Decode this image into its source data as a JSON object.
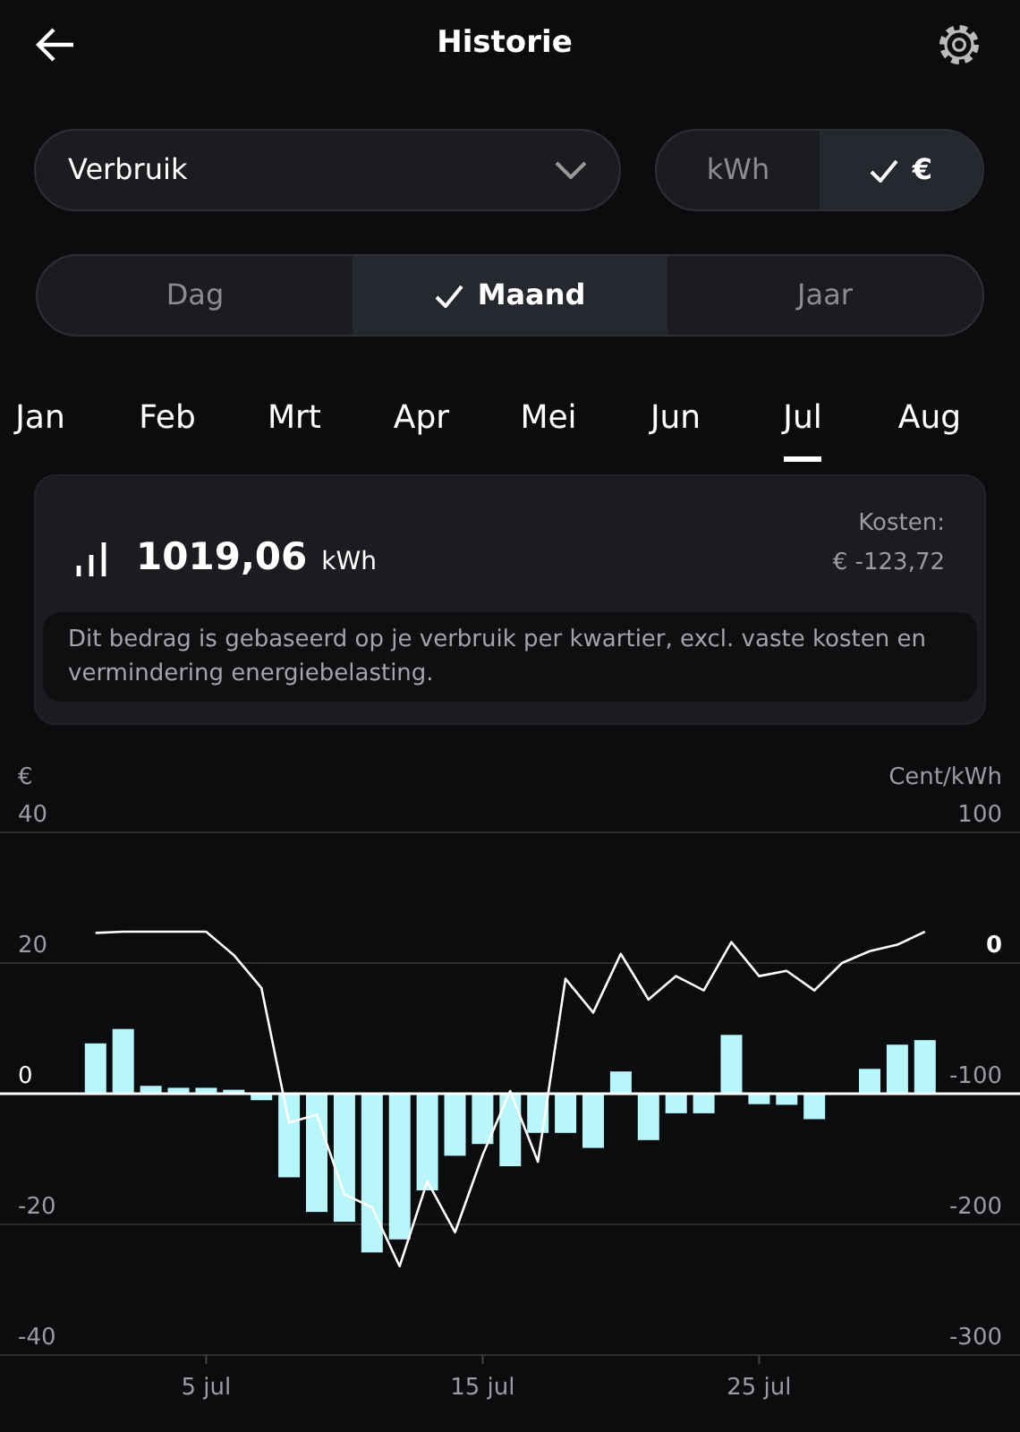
{
  "header": {
    "title": "Historie"
  },
  "type_select": {
    "value": "Verbruik"
  },
  "unit_toggle": [
    {
      "label": "kWh",
      "selected": false
    },
    {
      "label": "€",
      "selected": true
    }
  ],
  "period_tabs": [
    {
      "label": "Dag",
      "selected": false
    },
    {
      "label": "Maand",
      "selected": true
    },
    {
      "label": "Jaar",
      "selected": false
    }
  ],
  "months": [
    {
      "label": "Jan",
      "selected": false
    },
    {
      "label": "Feb",
      "selected": false
    },
    {
      "label": "Mrt",
      "selected": false
    },
    {
      "label": "Apr",
      "selected": false
    },
    {
      "label": "Mei",
      "selected": false
    },
    {
      "label": "Jun",
      "selected": false
    },
    {
      "label": "Jul",
      "selected": true
    },
    {
      "label": "Aug",
      "selected": false
    }
  ],
  "summary": {
    "usage": "1019,06",
    "unit": "kWh",
    "cost_label": "Kosten:",
    "cost": "€ -123,72",
    "note": "Dit bedrag is gebaseerd op je verbruik per kwartier, excl. vaste kosten en vermindering energiebelasting."
  },
  "chart": {
    "chart_data": {
      "type": "bar",
      "ylabel": "€",
      "categories": [
        null,
        null,
        null,
        null,
        "5 jul",
        null,
        null,
        null,
        null,
        null,
        null,
        null,
        null,
        null,
        "15 jul",
        null,
        null,
        null,
        null,
        null,
        null,
        null,
        null,
        null,
        "25 jul",
        null,
        null,
        null,
        null,
        null,
        null
      ],
      "ylim": [
        -40,
        40
      ],
      "yticks": [
        -40,
        -20,
        0,
        20,
        40
      ],
      "series": [
        {
          "color": "#b8f6fb",
          "values": [
            7.7,
            9.9,
            1.2,
            0.9,
            0.9,
            0.6,
            -1.0,
            -12.8,
            -18.1,
            -19.6,
            -24.3,
            -22.3,
            -14.8,
            -9.5,
            -7.7,
            -11.1,
            -6.0,
            -6.0,
            -8.3,
            3.4,
            -7.1,
            -3.0,
            -3.0,
            9.0,
            -1.6,
            -1.7,
            -3.9,
            null,
            3.8,
            7.5,
            8.2
          ]
        }
      ]
    }
  },
  "price_chart": {
    "chart_data": {
      "type": "line",
      "ylabel": "Cent/kWh",
      "ylim": [
        -300,
        100
      ],
      "yticks": [
        -300,
        -200,
        -100,
        0,
        100
      ],
      "series": [
        {
          "color": "#ffffff",
          "values": [
            23,
            24,
            24,
            24,
            24,
            6,
            -19,
            -122,
            -116,
            -177,
            -187,
            -232,
            -167,
            -206,
            -147,
            -98,
            -152,
            -12,
            -38,
            7,
            -28,
            -10,
            -21,
            16,
            -10,
            -6,
            -21,
            0,
            9,
            14,
            24
          ]
        }
      ]
    }
  }
}
